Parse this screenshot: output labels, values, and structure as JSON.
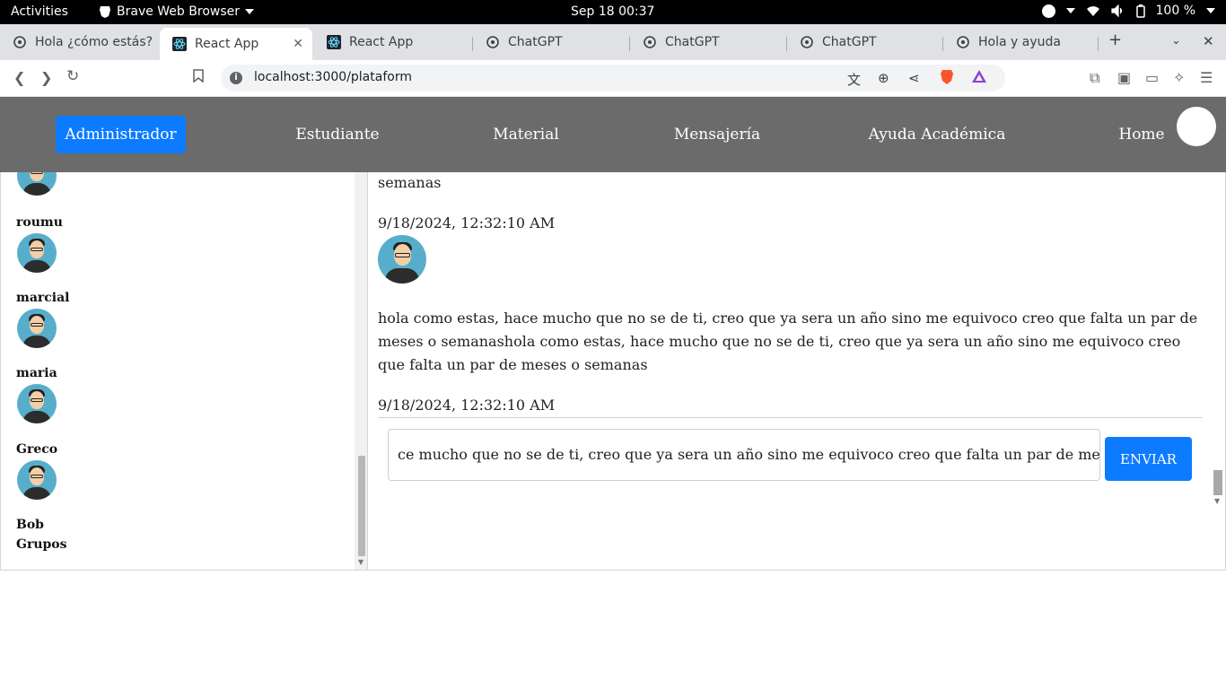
{
  "system": {
    "activities": "Activities",
    "app_name": "Brave Web Browser",
    "clock": "Sep 18  00:37",
    "battery": "100 %"
  },
  "tabs": [
    {
      "title": "Hola ¿cómo estás?",
      "icon": "chatgpt-icon"
    },
    {
      "title": "React App",
      "icon": "react-icon",
      "active": true
    },
    {
      "title": "React App",
      "icon": "react-icon"
    },
    {
      "title": "ChatGPT",
      "icon": "chatgpt-icon"
    },
    {
      "title": "ChatGPT",
      "icon": "chatgpt-icon"
    },
    {
      "title": "ChatGPT",
      "icon": "chatgpt-icon"
    },
    {
      "title": "Hola y ayuda",
      "icon": "chatgpt-icon"
    }
  ],
  "address": {
    "url": "localhost:3000/plataform"
  },
  "nav": {
    "items": [
      "Administrador",
      "Estudiante",
      "Material",
      "Mensajería",
      "Ayuda Académica",
      "Home"
    ]
  },
  "sidebar": {
    "users": [
      "roumu",
      "marcial",
      "maria",
      "Greco",
      "Bob"
    ],
    "groups_label": "Grupos"
  },
  "chat": {
    "top_fragment": "semanas",
    "messages": [
      {
        "timestamp": "9/18/2024, 12:32:10 AM"
      },
      {
        "text": "hola como estas, hace mucho que no se de ti, creo que ya sera un año sino me equivoco creo que falta un par de meses o semanashola como estas, hace mucho que no se de ti, creo que ya sera un año sino me equivoco creo que falta un par de meses o semanas",
        "timestamp": "9/18/2024, 12:32:10 AM"
      }
    ],
    "input_value": "ce mucho que no se de ti, creo que ya sera un año sino me equivoco creo que falta un par de meses o semanas",
    "send_label": "ENVIAR"
  },
  "colors": {
    "nav_bg": "#6b6b6b",
    "primary": "#0d7bff",
    "avatar_bg": "#57aecb"
  }
}
